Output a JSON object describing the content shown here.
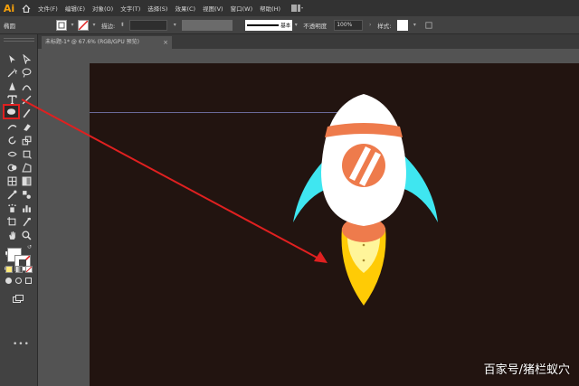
{
  "app": {
    "logo": "Ai"
  },
  "menu": {
    "items": [
      "文件(F)",
      "编辑(E)",
      "对象(O)",
      "文字(T)",
      "选择(S)",
      "效果(C)",
      "视图(V)",
      "窗口(W)",
      "帮助(H)"
    ]
  },
  "control": {
    "selection_label": "椭圆",
    "stroke_label": "描边:",
    "stroke_profile": "基本",
    "opacity_label": "不透明度",
    "opacity_value": "100%",
    "style_label": "样式:"
  },
  "document": {
    "tab_title": "未标题-1* @ 67.6% (RGB/GPU 预览)",
    "tab_close": "×"
  },
  "toolbar": {
    "more": "•••"
  },
  "watermark": "百家号/猪栏蚁穴",
  "colors": {
    "artboard": "#221410",
    "rocket_body": "#ffffff",
    "rocket_band": "#ee7b4c",
    "rocket_wing": "#3fe6f0",
    "flame_outer": "#ffcb05",
    "flame_inner": "#fff59a",
    "annotation": "#e02020"
  }
}
